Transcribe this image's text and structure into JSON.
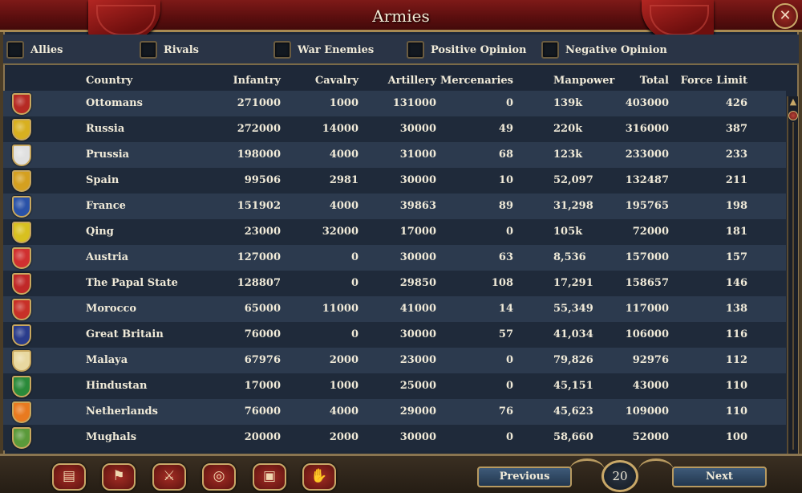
{
  "window": {
    "title": "Armies",
    "close_icon": "✕"
  },
  "filters": [
    {
      "label": "Allies"
    },
    {
      "label": "Rivals"
    },
    {
      "label": "War Enemies"
    },
    {
      "label": "Positive Opinion"
    },
    {
      "label": "Negative Opinion"
    }
  ],
  "columns": {
    "country": "Country",
    "infantry": "Infantry",
    "cavalry": "Cavalry",
    "artillery": "Artillery",
    "mercenaries": "Mercenaries",
    "manpower": "Manpower",
    "total": "Total",
    "force_limit": "Force Limit"
  },
  "rows": [
    {
      "country": "Ottomans",
      "infantry": "271000",
      "cavalry": "1000",
      "artillery": "131000",
      "mercenaries": "0",
      "manpower": "139k",
      "total": "403000",
      "force_limit": "426",
      "shield": "#b62a24"
    },
    {
      "country": "Russia",
      "infantry": "272000",
      "cavalry": "14000",
      "artillery": "30000",
      "mercenaries": "49",
      "manpower": "220k",
      "total": "316000",
      "force_limit": "387",
      "shield": "#d8b020"
    },
    {
      "country": "Prussia",
      "infantry": "198000",
      "cavalry": "4000",
      "artillery": "31000",
      "mercenaries": "68",
      "manpower": "123k",
      "total": "233000",
      "force_limit": "233",
      "shield": "#e0e0e0"
    },
    {
      "country": "Spain",
      "infantry": "99506",
      "cavalry": "2981",
      "artillery": "30000",
      "mercenaries": "10",
      "manpower": "52,097",
      "total": "132487",
      "force_limit": "211",
      "shield": "#d4a020"
    },
    {
      "country": "France",
      "infantry": "151902",
      "cavalry": "4000",
      "artillery": "39863",
      "mercenaries": "89",
      "manpower": "31,298",
      "total": "195765",
      "force_limit": "198",
      "shield": "#2a52a8"
    },
    {
      "country": "Qing",
      "infantry": "23000",
      "cavalry": "32000",
      "artillery": "17000",
      "mercenaries": "0",
      "manpower": "105k",
      "total": "72000",
      "force_limit": "181",
      "shield": "#d8c020"
    },
    {
      "country": "Austria",
      "infantry": "127000",
      "cavalry": "0",
      "artillery": "30000",
      "mercenaries": "63",
      "manpower": "8,536",
      "total": "157000",
      "force_limit": "157",
      "shield": "#d03030"
    },
    {
      "country": "The Papal State",
      "infantry": "128807",
      "cavalry": "0",
      "artillery": "29850",
      "mercenaries": "108",
      "manpower": "17,291",
      "total": "158657",
      "force_limit": "146",
      "shield": "#c02828"
    },
    {
      "country": "Morocco",
      "infantry": "65000",
      "cavalry": "11000",
      "artillery": "41000",
      "mercenaries": "14",
      "manpower": "55,349",
      "total": "117000",
      "force_limit": "138",
      "shield": "#c83028"
    },
    {
      "country": "Great Britain",
      "infantry": "76000",
      "cavalry": "0",
      "artillery": "30000",
      "mercenaries": "57",
      "manpower": "41,034",
      "total": "106000",
      "force_limit": "116",
      "shield": "#2a3c8c"
    },
    {
      "country": "Malaya",
      "infantry": "67976",
      "cavalry": "2000",
      "artillery": "23000",
      "mercenaries": "0",
      "manpower": "79,826",
      "total": "92976",
      "force_limit": "112",
      "shield": "#e8d8a0"
    },
    {
      "country": "Hindustan",
      "infantry": "17000",
      "cavalry": "1000",
      "artillery": "25000",
      "mercenaries": "0",
      "manpower": "45,151",
      "total": "43000",
      "force_limit": "110",
      "shield": "#2a8a3a"
    },
    {
      "country": "Netherlands",
      "infantry": "76000",
      "cavalry": "4000",
      "artillery": "29000",
      "mercenaries": "76",
      "manpower": "45,623",
      "total": "109000",
      "force_limit": "110",
      "shield": "#e87a20"
    },
    {
      "country": "Mughals",
      "infantry": "20000",
      "cavalry": "2000",
      "artillery": "30000",
      "mercenaries": "0",
      "manpower": "58,660",
      "total": "52000",
      "force_limit": "100",
      "shield": "#5a9a3a"
    }
  ],
  "toolbar": [
    {
      "name": "ledger-icon",
      "glyph": "▤"
    },
    {
      "name": "flags-icon",
      "glyph": "⚑"
    },
    {
      "name": "crossed-swords-icon",
      "glyph": "⚔"
    },
    {
      "name": "coins-icon",
      "glyph": "◎"
    },
    {
      "name": "trade-goods-icon",
      "glyph": "▣"
    },
    {
      "name": "handshake-icon",
      "glyph": "✋"
    }
  ],
  "pagination": {
    "previous": "Previous",
    "next": "Next",
    "page": "20"
  }
}
